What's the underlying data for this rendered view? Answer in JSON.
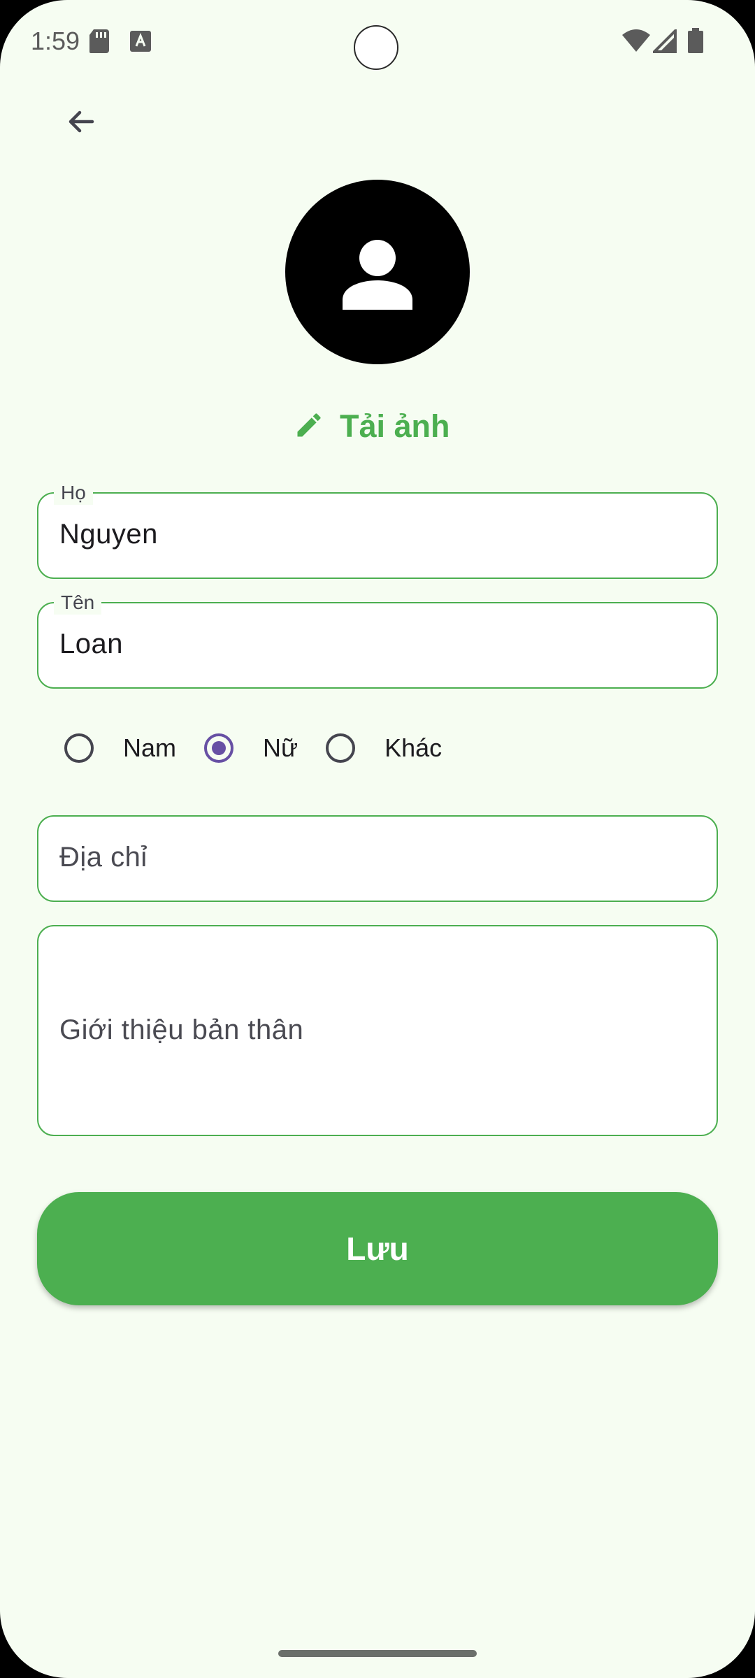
{
  "status_bar": {
    "time": "1:59"
  },
  "avatar": {
    "icon": "person-icon",
    "background": "#000000"
  },
  "upload": {
    "label": "Tải ảnh",
    "icon": "pencil-icon",
    "color": "#4caf50"
  },
  "form": {
    "last_name": {
      "label": "Họ",
      "value": "Nguyen"
    },
    "first_name": {
      "label": "Tên",
      "value": "Loan"
    },
    "gender": {
      "options": [
        "Nam",
        "Nữ",
        "Khác"
      ],
      "selected": "Nữ"
    },
    "address": {
      "placeholder": "Địa chỉ"
    },
    "bio": {
      "placeholder": "Giới thiệu bản thân"
    }
  },
  "save_button": {
    "label": "Lưu"
  },
  "colors": {
    "accent": "#4caf50",
    "radio_selected": "#6750a4",
    "background": "#f6fdf2"
  }
}
